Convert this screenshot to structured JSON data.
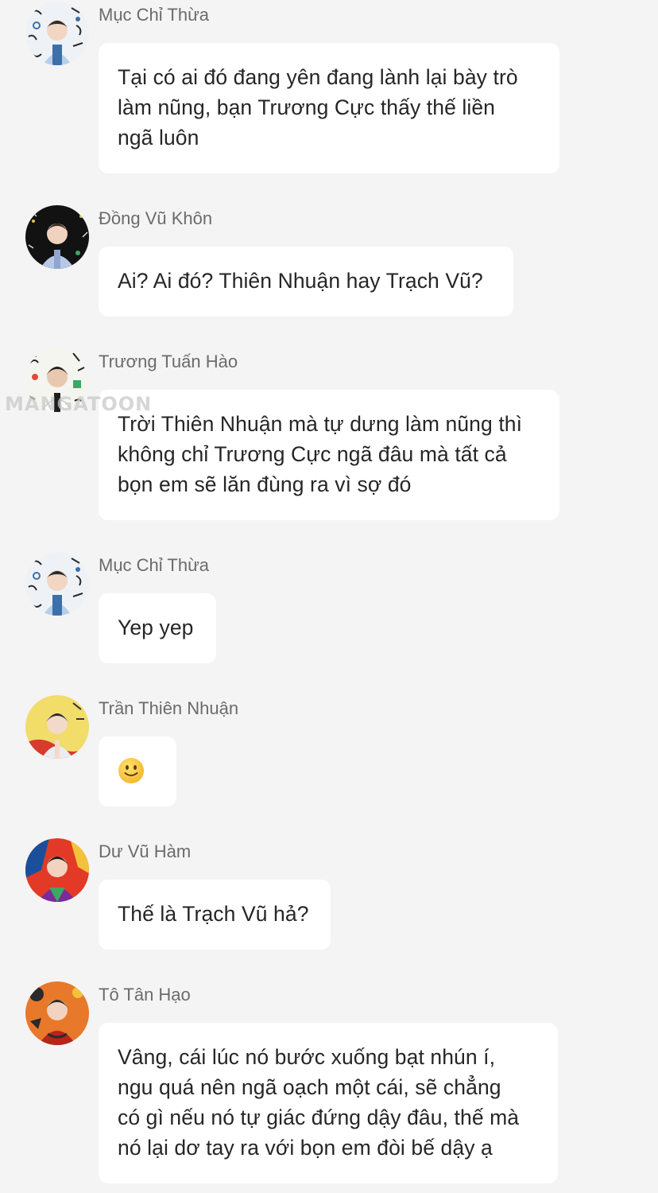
{
  "messages": [
    {
      "sender": "Mục Chỉ Thừa",
      "avatar_icon": "avatar-icon",
      "avatar_palette": [
        "#eef2f6",
        "#3d6fa8",
        "#2b2b2b"
      ],
      "text": "Tại có ai đó đang yên đang lành lại bày trò\nlàm nũng, bạn Trương Cực thấy thế liền\nngã luôn"
    },
    {
      "sender": "Đồng Vũ Khôn",
      "avatar_icon": "avatar-icon",
      "avatar_palette": [
        "#121212",
        "#b7c8e6",
        "#f0d2c0"
      ],
      "text": "Ai? Ai đó? Thiên Nhuận hay Trạch Vũ?"
    },
    {
      "sender": "Trương Tuấn Hào",
      "avatar_icon": "avatar-icon",
      "avatar_palette": [
        "#f5f5f0",
        "#222222",
        "#e8c9b0"
      ],
      "text": "Trời Thiên Nhuận mà tự dưng làm nũng thì\nkhông chỉ Trương Cực ngã đâu mà tất cả\nbọn em sẽ lăn đùng ra vì sợ đó"
    },
    {
      "sender": "Mục Chỉ Thừa",
      "avatar_icon": "avatar-icon",
      "avatar_palette": [
        "#eef2f6",
        "#3d6fa8",
        "#2b2b2b"
      ],
      "text": "Yep yep"
    },
    {
      "sender": "Trần Thiên Nhuận",
      "avatar_icon": "avatar-icon",
      "avatar_palette": [
        "#f2dc6a",
        "#e9ecf3",
        "#d83a2c"
      ],
      "emoji": "slightly-smiling-face-icon"
    },
    {
      "sender": "Dư Vũ Hàm",
      "avatar_icon": "avatar-icon",
      "avatar_palette": [
        "#e23a26",
        "#1b4f9c",
        "#f3c23a"
      ],
      "text": "Thế là Trạch Vũ hả?"
    },
    {
      "sender": "Tô Tân Hạo",
      "avatar_icon": "avatar-icon",
      "avatar_palette": [
        "#e8782a",
        "#b8241c",
        "#2a2a2a"
      ],
      "text": "Vâng, cái lúc nó bước xuống bạt nhún í,\nngu quá nên ngã oạch một cái, sẽ chẳng\ncó gì nếu nó tự giác đứng dậy đâu, thế mà\nnó lại dơ tay ra với bọn em đòi bế dậy ạ"
    }
  ],
  "watermark": "MANGATOON"
}
